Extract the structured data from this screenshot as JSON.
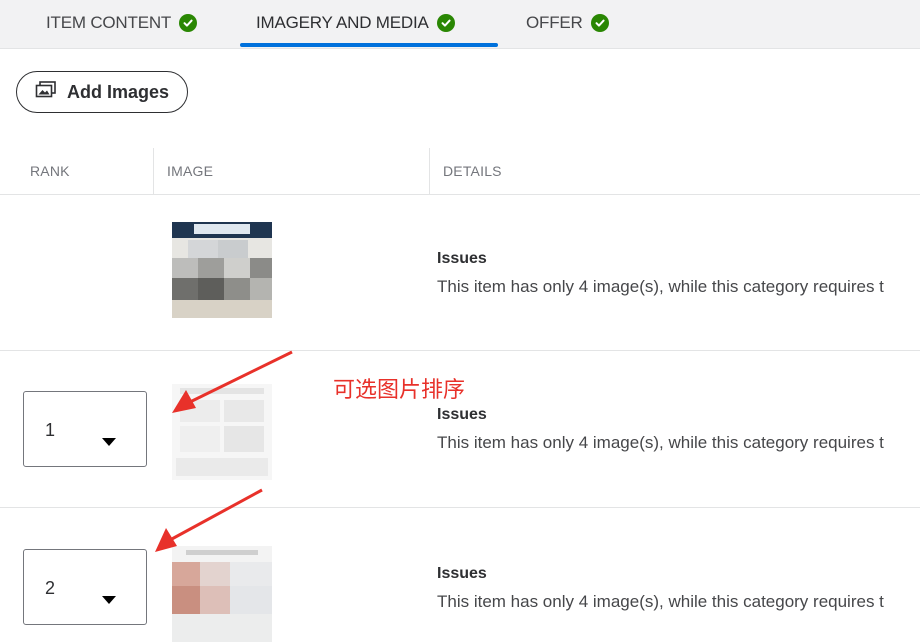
{
  "tabs": [
    {
      "label": "ITEM CONTENT",
      "status": "complete",
      "active": false
    },
    {
      "label": "IMAGERY AND MEDIA",
      "status": "complete",
      "active": true
    },
    {
      "label": "OFFER",
      "status": "complete",
      "active": false
    }
  ],
  "toolbar": {
    "add_images_label": "Add Images",
    "add_images_icon": "image-icon"
  },
  "table": {
    "columns": [
      "RANK",
      "IMAGE",
      "DETAILS"
    ],
    "rows": [
      {
        "rank": "",
        "issue_title": "Issues",
        "issue_text": "This item has only 4 image(s), while this category requires t"
      },
      {
        "rank": "1",
        "issue_title": "Issues",
        "issue_text": "This item has only 4 image(s), while this category requires t"
      },
      {
        "rank": "2",
        "issue_title": "Issues",
        "issue_text": "This item has only 4 image(s), while this category requires t"
      }
    ]
  },
  "annotation": {
    "text": "可选图片排序",
    "color": "#e8312a"
  },
  "colors": {
    "accent": "#0071dc",
    "success": "#2a8703",
    "annotation": "#e8312a"
  }
}
